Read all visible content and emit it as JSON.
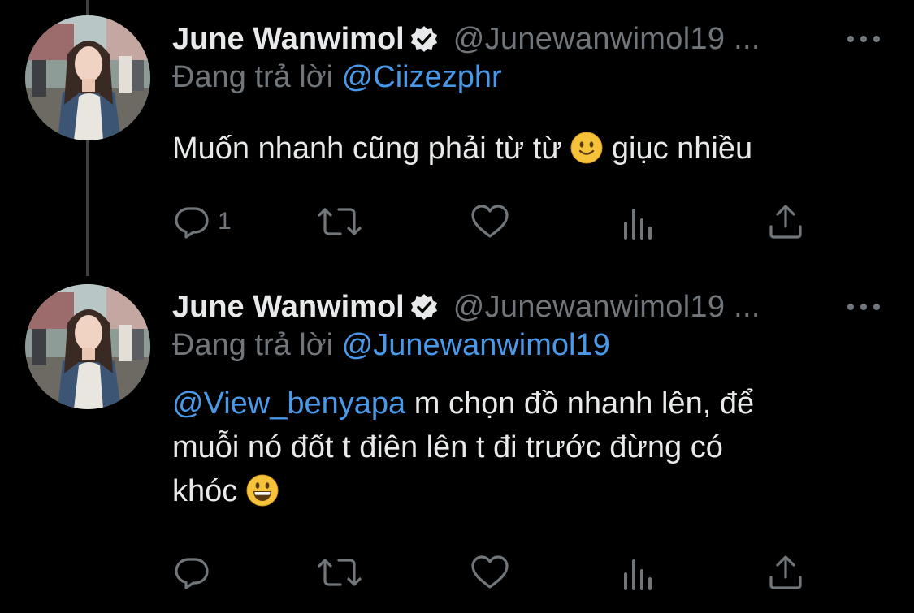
{
  "theme": {
    "background": "#000000",
    "text": "#e7e9ea",
    "muted": "#71767b",
    "link": "#4a99e9",
    "thread_line": "#3e4144"
  },
  "tweets": [
    {
      "author": {
        "display_name": "June Wanwimol",
        "handle": "@Junewanwimol19 ...",
        "verified": true,
        "avatar": "avatar-photo"
      },
      "reply_prefix": "Đang trả lời",
      "reply_to": "@Ciizezphr",
      "body_text": "Muốn nhanh cũng phải từ từ",
      "body_emoji": "slightly-smiling-face-emoji",
      "body_text_after": "giục nhiều",
      "actions": {
        "reply_icon": "reply-icon",
        "reply_count": "1",
        "retweet_icon": "retweet-icon",
        "like_icon": "like-icon",
        "views_icon": "views-icon",
        "share_icon": "share-icon"
      }
    },
    {
      "author": {
        "display_name": "June Wanwimol",
        "handle": "@Junewanwimol19 ...",
        "verified": true,
        "avatar": "avatar-photo"
      },
      "reply_prefix": "Đang trả lời",
      "reply_to": "@Junewanwimol19",
      "body_mention": "@View_benyapa",
      "body_text_line1": "m chọn đồ nhanh lên, để",
      "body_text_line2": "muỗi nó đốt t điên lên t đi trước đừng có",
      "body_text_line3": "khóc",
      "body_emoji": "grinning-face-emoji",
      "actions": {
        "reply_icon": "reply-icon",
        "retweet_icon": "retweet-icon",
        "like_icon": "like-icon",
        "views_icon": "views-icon",
        "share_icon": "share-icon"
      }
    }
  ]
}
